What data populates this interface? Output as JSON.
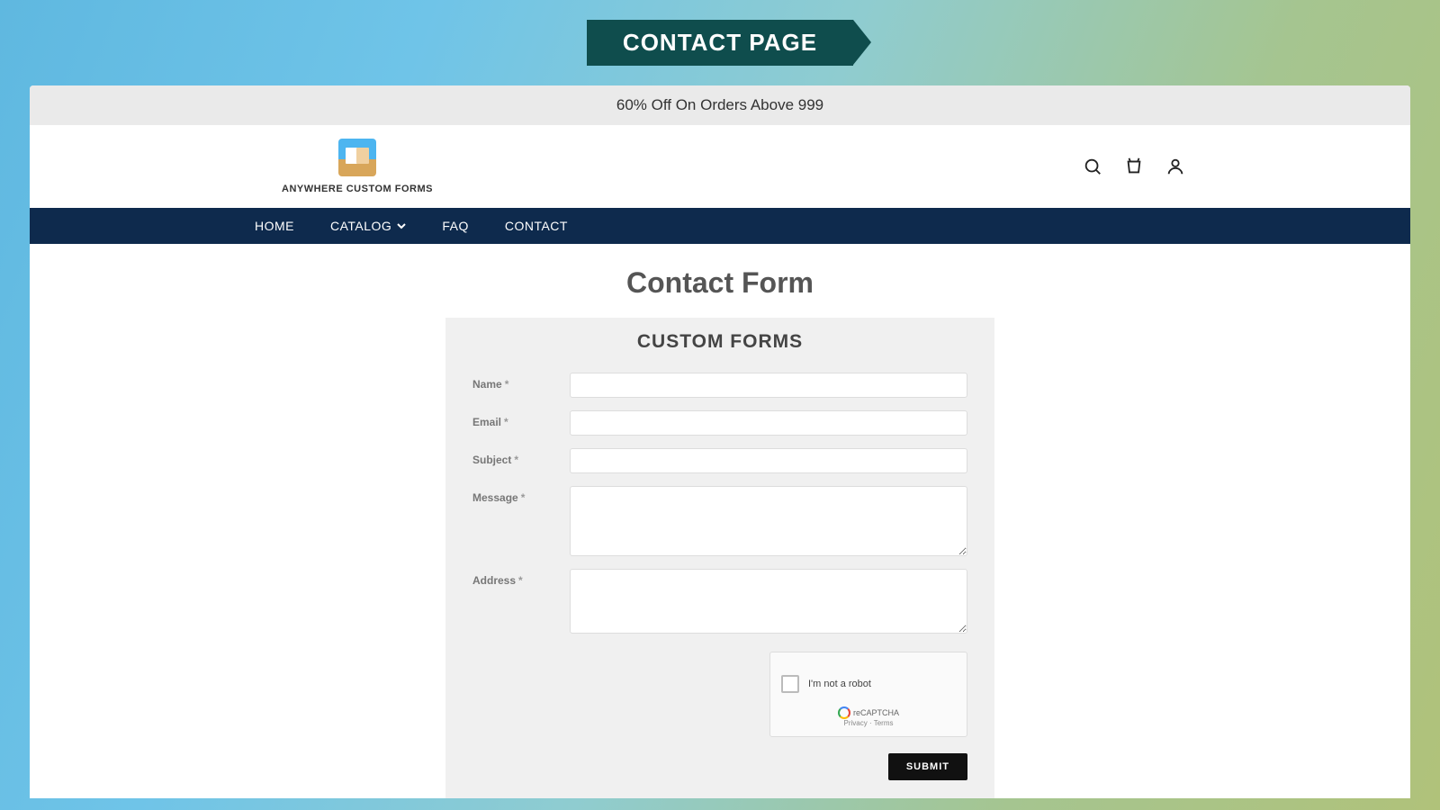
{
  "banner": {
    "title": "CONTACT PAGE"
  },
  "promo": {
    "text": "60% Off On Orders Above 999"
  },
  "logo": {
    "text": "ANYWHERE CUSTOM FORMS"
  },
  "nav": {
    "home": "HOME",
    "catalog": "CATALOG",
    "faq": "FAQ",
    "contact": "CONTACT"
  },
  "page": {
    "title": "Contact Form"
  },
  "form": {
    "title": "CUSTOM FORMS",
    "name_label": "Name",
    "email_label": "Email",
    "subject_label": "Subject",
    "message_label": "Message",
    "address_label": "Address",
    "required": "*",
    "name_value": "",
    "email_value": "",
    "subject_value": "",
    "message_value": "",
    "address_value": "",
    "submit": "SUBMIT"
  },
  "captcha": {
    "label": "I'm not a robot",
    "brand": "reCAPTCHA",
    "links": "Privacy · Terms"
  }
}
